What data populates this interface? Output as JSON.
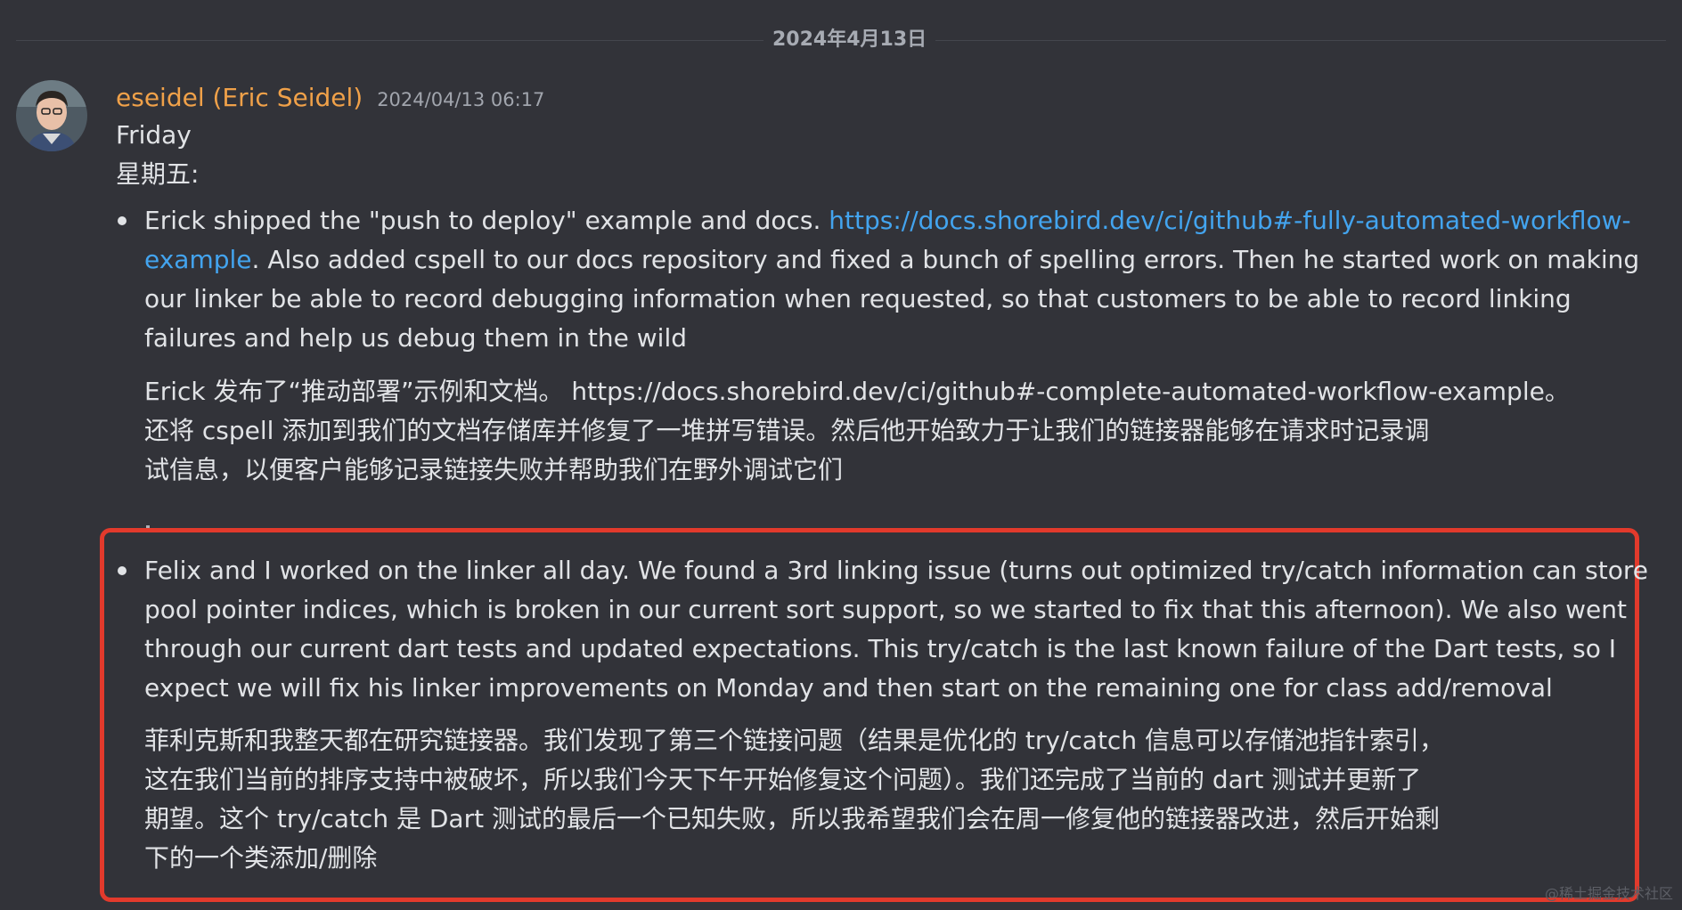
{
  "divider": {
    "date": "2024年4月13日"
  },
  "message": {
    "author": "eseidel (Eric Seidel)",
    "timestamp": "2024/04/13 06:17",
    "avatar": "avatar-photo",
    "heading_en": "Friday",
    "heading_zh": "星期五:",
    "bullets": [
      {
        "en_lines": [
          "Erick shipped the \"push to deploy\" example and docs.  ",
          ". Also added cspell to our docs repository and fixed a bunch of spelling errors.   Then he started work on making",
          "our linker be able to record debugging information when requested, so that customers to be able to record linking",
          "failures and help us debug them  in the wild"
        ],
        "link_part1": "https://docs.shorebird.dev/ci/github#-fully-automated-workflow-",
        "link_part2": "example",
        "zh_lines": [
          "Erick 发布了“推动部署”示例和文档。 https://docs.shorebird.dev/ci/github#-complete-automated-workflow-example。",
          "还将 cspell 添加到我们的文档存储库并修复了一堆拼写错误。然后他开始致力于让我们的链接器能够在请求时记录调",
          "试信息，以便客户能够记录链接失败并帮助我们在野外调试它们"
        ]
      },
      {
        "en_lines": [
          "Felix and I worked on the linker all day.  We found a 3rd linking issue (turns out optimized try/catch information can store",
          "pool pointer indices, which is broken in our current sort support, so we started to fix that this afternoon).  We also went",
          "through our current dart tests and updated expectations.  This try/catch is the last known failure of the Dart tests, so I",
          "expect we will fix his linker improvements on Monday and then start on the remaining one for class add/removal"
        ],
        "zh_lines": [
          "菲利克斯和我整天都在研究链接器。我们发现了第三个链接问题（结果是优化的 try/catch 信息可以存储池指针索引，",
          "这在我们当前的排序支持中被破坏，所以我们今天下午开始修复这个问题）。我们还完成了当前的 dart 测试并更新了",
          "期望。这个 try/catch 是 Dart 测试的最后一个已知失败，所以我希望我们会在周一修复他的链接器改进，然后开始剩",
          "下的一个类添加/删除"
        ]
      }
    ]
  },
  "watermark": "@稀土掘金技术社区",
  "colors": {
    "background": "#323339",
    "author": "#f0a149",
    "link": "#43a4ef",
    "highlight": "#e23a2c"
  }
}
